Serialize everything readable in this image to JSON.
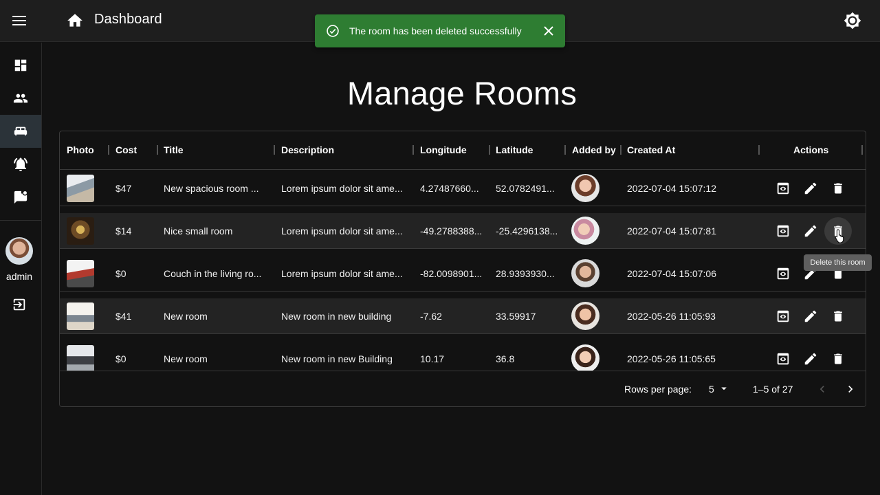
{
  "appbar": {
    "title": "Dashboard",
    "menu_icon": "menu-icon",
    "home_icon": "home-icon",
    "theme_icon": "brightness-icon"
  },
  "snackbar": {
    "message": "The room has been deleted successfully",
    "color": "#2e7d32"
  },
  "sidebar": {
    "items": [
      {
        "name": "dashboard-icon",
        "active": false
      },
      {
        "name": "users-icon",
        "active": false
      },
      {
        "name": "bed-icon",
        "active": true
      },
      {
        "name": "alarm-icon",
        "active": false
      },
      {
        "name": "message-icon",
        "active": false
      }
    ],
    "user": {
      "label": "admin"
    },
    "logout_icon": "logout-icon"
  },
  "page": {
    "title": "Manage Rooms"
  },
  "table": {
    "columns": [
      "Photo",
      "Cost",
      "Title",
      "Description",
      "Longitude",
      "Latitude",
      "Added by",
      "Created At",
      "Actions"
    ],
    "rows": [
      {
        "cost": "$47",
        "title": "New spacious room ...",
        "description": "Lorem ipsum dolor sit ame...",
        "longitude": "4.27487660...",
        "latitude": "52.0782491...",
        "created_at": "2022-07-04 15:07:12"
      },
      {
        "cost": "$14",
        "title": "Nice small room",
        "description": "Lorem ipsum dolor sit ame...",
        "longitude": "-49.2788388...",
        "latitude": "-25.4296138...",
        "created_at": "2022-07-04 15:07:81"
      },
      {
        "cost": "$0",
        "title": "Couch in the living ro...",
        "description": "Lorem ipsum dolor sit ame...",
        "longitude": "-82.0098901...",
        "latitude": "28.9393930...",
        "created_at": "2022-07-04 15:07:06"
      },
      {
        "cost": "$41",
        "title": "New room",
        "description": "New room in new building",
        "longitude": "-7.62",
        "latitude": "33.59917",
        "created_at": "2022-05-26 11:05:93"
      },
      {
        "cost": "$0",
        "title": "New room",
        "description": "New room in new Building",
        "longitude": "10.17",
        "latitude": "36.8",
        "created_at": "2022-05-26 11:05:65"
      }
    ],
    "tooltip": "Delete this room"
  },
  "pagination": {
    "rows_per_page_label": "Rows per page:",
    "rows_per_page": "5",
    "range": "1–5 of 27"
  }
}
